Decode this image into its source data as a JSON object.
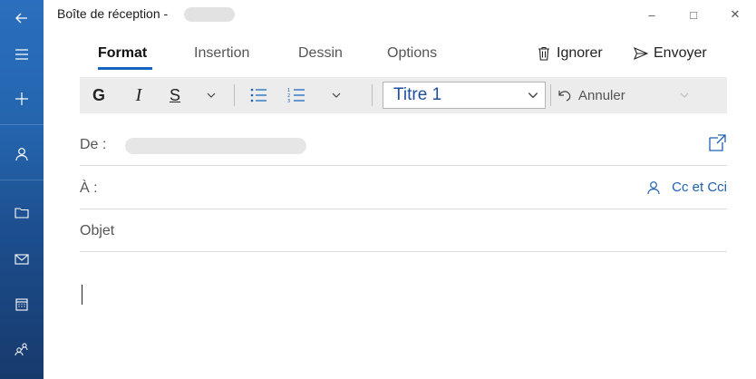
{
  "window": {
    "title": "Boîte de réception -",
    "controls": {
      "minimize": "–",
      "maximize": "□",
      "close": "✕"
    }
  },
  "rail": {
    "items": [
      {
        "name": "back",
        "icon": "back-arrow-icon"
      },
      {
        "name": "menu",
        "icon": "hamburger-icon"
      },
      {
        "name": "new",
        "icon": "plus-icon"
      },
      {
        "name": "accounts",
        "icon": "person-icon"
      },
      {
        "name": "folders",
        "icon": "folder-icon"
      },
      {
        "name": "mail",
        "icon": "mail-icon"
      },
      {
        "name": "calendar",
        "icon": "calendar-icon"
      },
      {
        "name": "people",
        "icon": "people-icon"
      }
    ]
  },
  "tabs": [
    {
      "label": "Format",
      "active": true
    },
    {
      "label": "Insertion",
      "active": false
    },
    {
      "label": "Dessin",
      "active": false
    },
    {
      "label": "Options",
      "active": false
    }
  ],
  "commands": {
    "discard": "Ignorer",
    "send": "Envoyer"
  },
  "toolbar": {
    "bold": "G",
    "italic": "I",
    "underline": "S",
    "style_value": "Titre 1",
    "undo": "Annuler"
  },
  "fields": {
    "from_label": "De :",
    "to_label": "À :",
    "cc_bcc": "Cc et Cci",
    "subject_placeholder": "Objet"
  },
  "colors": {
    "accent": "#1565c0",
    "rail_top": "#2a6fbd",
    "rail_bottom": "#173a6c",
    "toolbar_bg": "#ececec",
    "style_text": "#1f4e9c"
  }
}
